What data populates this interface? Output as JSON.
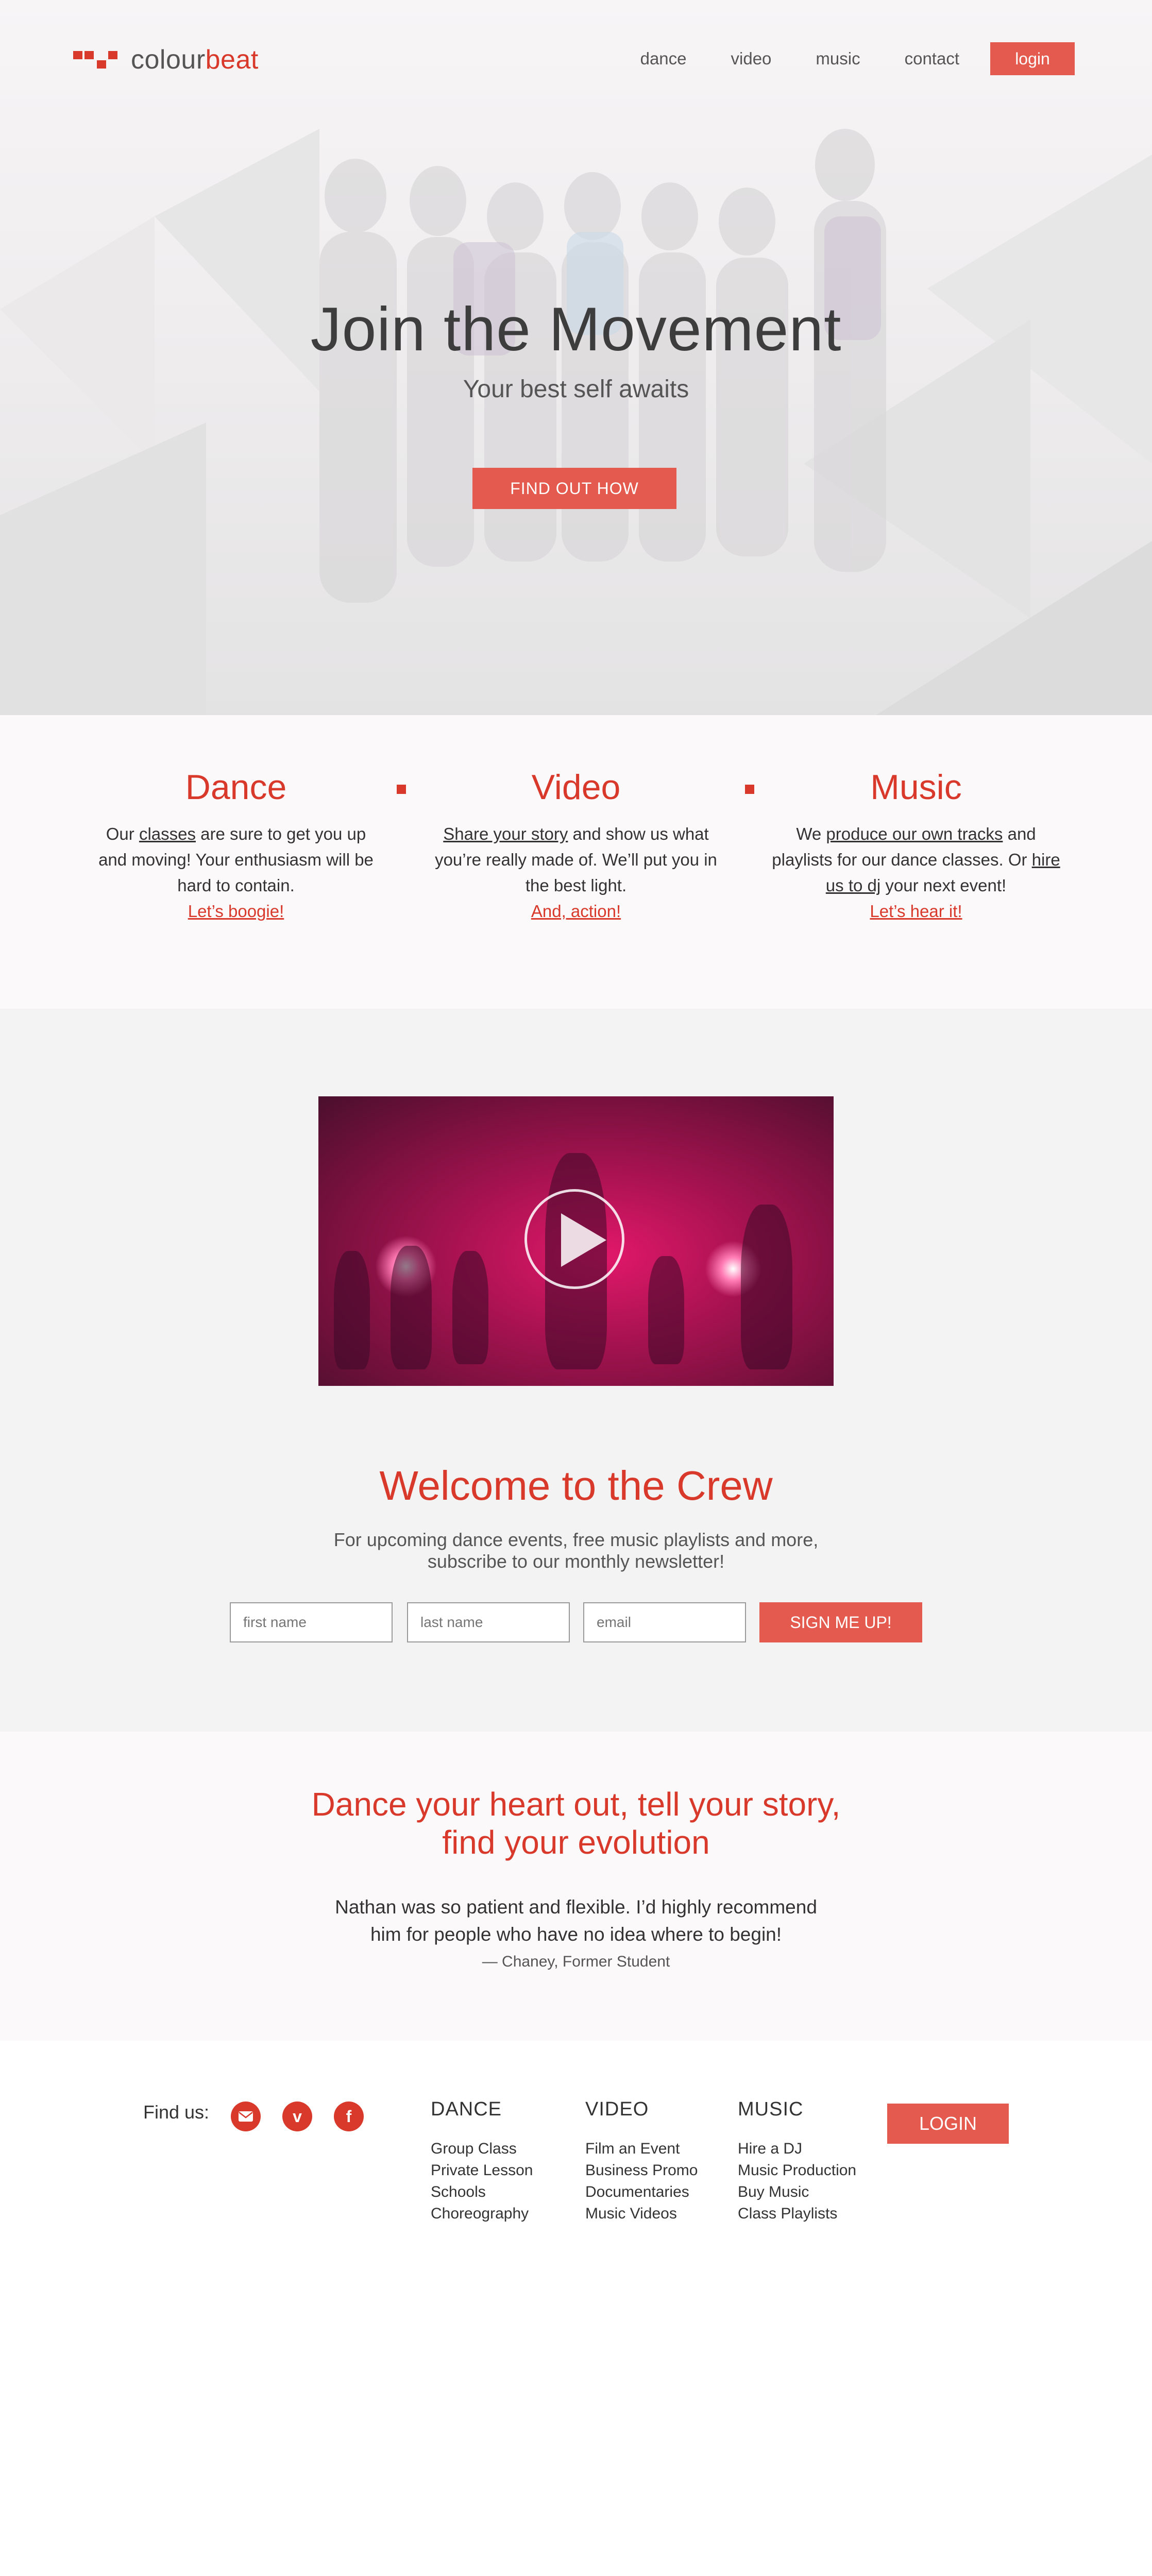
{
  "brand": {
    "name_part1": "colour",
    "name_part2": "beat",
    "accent": "#d8392b"
  },
  "nav": {
    "links": [
      "dance",
      "video",
      "music",
      "contact"
    ],
    "login": "login"
  },
  "hero": {
    "title": "Join the Movement",
    "subtitle": "Your best self awaits",
    "cta": "FIND OUT HOW"
  },
  "features": [
    {
      "title": "Dance",
      "lines": [
        "Our ",
        "classes",
        " are sure to get you up and moving! Your enthusiasm will be hard to contain."
      ],
      "link": "Let’s boogie!"
    },
    {
      "title": "Video",
      "lines": [
        "",
        "Share your story",
        " and show us what you’re really made of. We’ll put you in the best light."
      ],
      "link": "And, action!"
    },
    {
      "title": "Music",
      "lines": [
        "We ",
        "produce our own tracks",
        " and playlists for our dance classes. Or ",
        "hire us to dj",
        " your next event!"
      ],
      "link": "Let’s hear it!"
    }
  ],
  "crew": {
    "title": "Welcome to the Crew",
    "blurb": "For upcoming dance events, free music playlists and more, subscribe to our monthly newsletter!",
    "fields": {
      "first_name": "first name",
      "last_name": "last name",
      "email": "email"
    },
    "signup": "SIGN ME UP!"
  },
  "story": {
    "title_line1": "Dance your heart out, tell your story,",
    "title_line2": "find your evolution",
    "quote": "Nathan was so patient and flexible. I’d highly recommend him for people who have no idea where to begin!",
    "author": "— Chaney, Former Student"
  },
  "footer": {
    "find_us": "Find us:",
    "social_icons": [
      "email-icon",
      "vimeo-icon",
      "facebook-icon"
    ],
    "columns": [
      {
        "heading": "DANCE",
        "items": [
          "Group Class",
          "Private Lesson",
          "Schools",
          "Choreography"
        ]
      },
      {
        "heading": "VIDEO",
        "items": [
          "Film an Event",
          "Business Promo",
          "Documentaries",
          "Music Videos"
        ]
      },
      {
        "heading": "MUSIC",
        "items": [
          "Hire a DJ",
          "Music Production",
          "Buy Music",
          "Class Playlists"
        ]
      }
    ],
    "login": "LOGIN"
  }
}
